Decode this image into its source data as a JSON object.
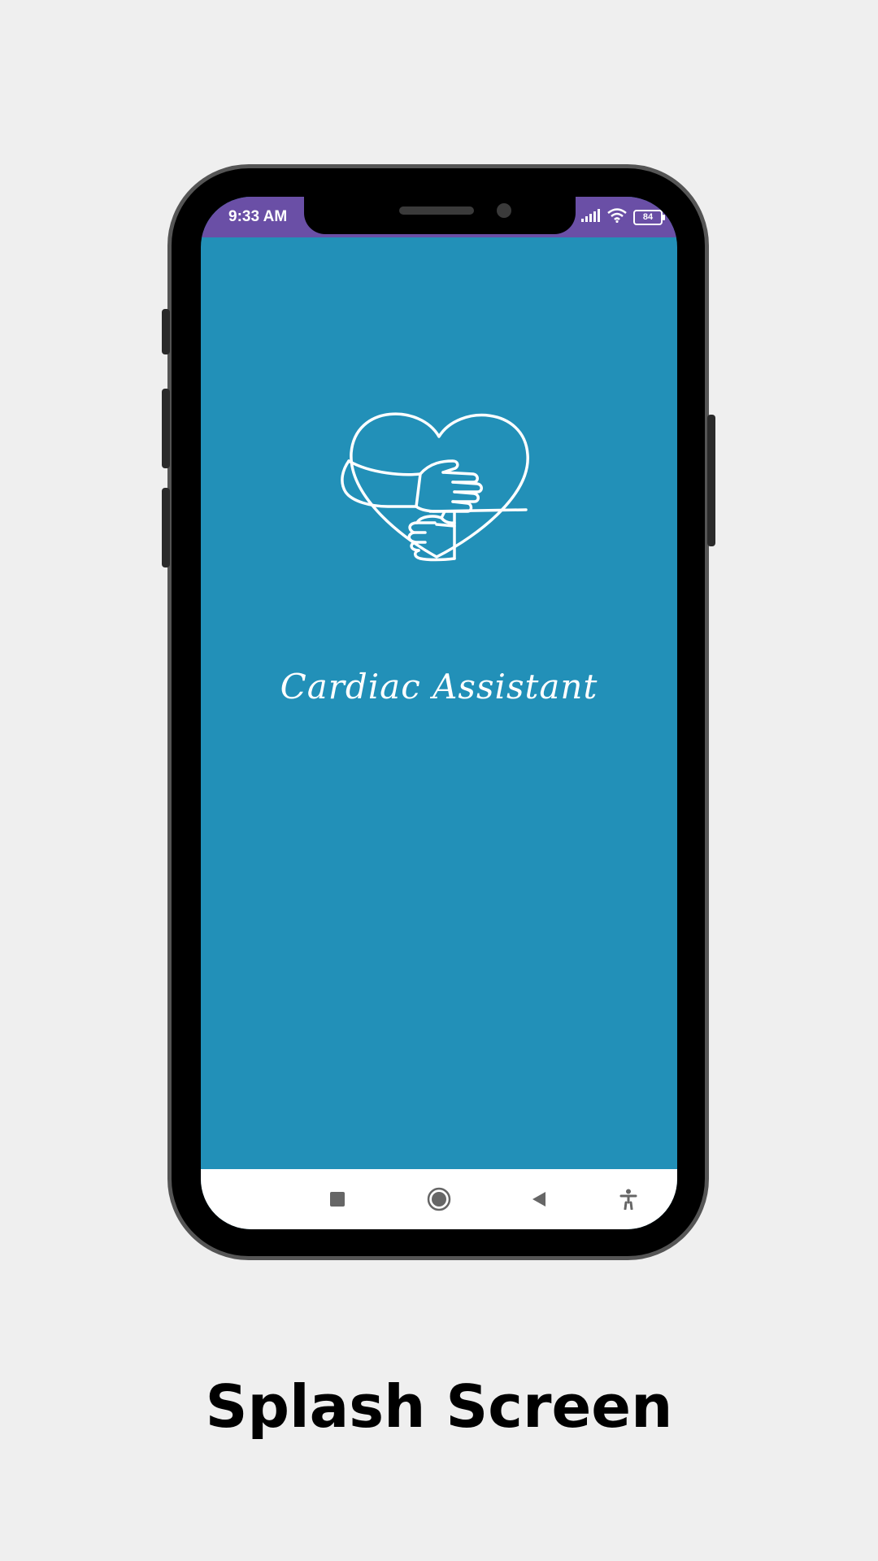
{
  "status_bar": {
    "time": "9:33 AM",
    "battery_level": "84",
    "icons": [
      "signal-icon",
      "wifi-icon",
      "battery-icon"
    ],
    "color": "#6a4fa6"
  },
  "splash": {
    "app_name": "Cardiac Assistant",
    "logo_icon": "heart-with-hands-icon",
    "background_color": "#2290b8"
  },
  "nav_bar": {
    "buttons": [
      "recents-square-icon",
      "home-circle-icon",
      "back-triangle-icon",
      "accessibility-icon"
    ]
  },
  "caption": "Splash Screen"
}
